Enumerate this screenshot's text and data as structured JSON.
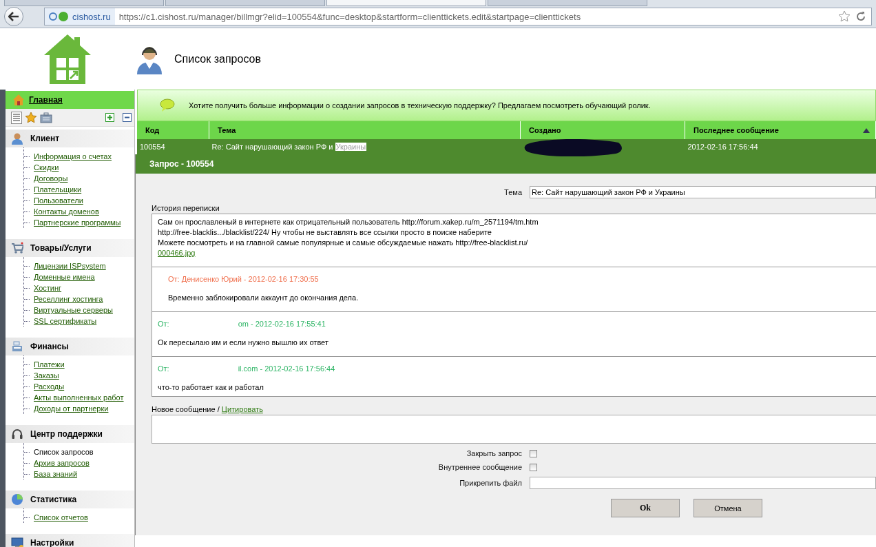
{
  "browser": {
    "tabs": [
      {
        "selected": false
      },
      {
        "selected": false
      },
      {
        "selected": true
      },
      {
        "selected": false
      }
    ],
    "site_badge": "cishost.ru",
    "url": "https://c1.cishost.ru/manager/billmgr?elid=100554&func=desktop&startform=clienttickets.edit&startpage=clienttickets"
  },
  "page_title": "Список запросов",
  "sidebar": {
    "home": "Главная",
    "groups": [
      {
        "title": "Клиент",
        "items": [
          {
            "label": "Информация о счетах",
            "selected": false
          },
          {
            "label": "Скидки",
            "selected": false
          },
          {
            "label": "Договоры",
            "selected": false
          },
          {
            "label": "Плательщики",
            "selected": false
          },
          {
            "label": "Пользователи",
            "selected": false
          },
          {
            "label": "Контакты доменов",
            "selected": false
          },
          {
            "label": "Партнерские программы",
            "selected": false
          }
        ]
      },
      {
        "title": "Товары/Услуги",
        "items": [
          {
            "label": "Лицензии ISPsystem",
            "selected": false
          },
          {
            "label": "Доменные имена",
            "selected": false
          },
          {
            "label": "Хостинг",
            "selected": false
          },
          {
            "label": "Реселлинг хостинга",
            "selected": false
          },
          {
            "label": "Виртуальные серверы",
            "selected": false
          },
          {
            "label": "SSL сертификаты",
            "selected": false
          }
        ]
      },
      {
        "title": "Финансы",
        "items": [
          {
            "label": "Платежи",
            "selected": false
          },
          {
            "label": "Заказы",
            "selected": false
          },
          {
            "label": "Расходы",
            "selected": false
          },
          {
            "label": "Акты выполненных работ",
            "selected": false
          },
          {
            "label": "Доходы от партнерки",
            "selected": false
          }
        ]
      },
      {
        "title": "Центр поддержки",
        "items": [
          {
            "label": "Список запросов",
            "selected": true
          },
          {
            "label": "Архив запросов",
            "selected": false
          },
          {
            "label": "База знаний",
            "selected": false
          }
        ]
      },
      {
        "title": "Статистика",
        "items": [
          {
            "label": "Список отчетов",
            "selected": false
          }
        ]
      },
      {
        "title": "Настройки"
      }
    ]
  },
  "banner": "Хотите получить больше информации о создании запросов в техническую поддержку? Предлагаем посмотреть обучающий ролик.",
  "table": {
    "columns": [
      {
        "label": "Код",
        "sorted": false
      },
      {
        "label": "Тема",
        "sorted": false
      },
      {
        "label": "Создано",
        "sorted": false
      },
      {
        "label": "Последнее сообщение",
        "sorted": true
      }
    ],
    "rows": [
      {
        "code": "100554",
        "topic": "Re: Сайт нарушающий закон РФ и",
        "topic_highlight": "Украины",
        "created_redacted": true,
        "last_message": "2012-02-16 17:56:44",
        "selected": true
      }
    ]
  },
  "dialog": {
    "title": "Запрос - 100554",
    "topic_label": "Тема",
    "topic_value": "Re: Сайт нарушающий закон РФ и  Украины",
    "history_label": "История переписки",
    "messages": [
      {
        "kind": "client",
        "lines": [
          "Сам он прославленый в интернете как отрицательный пользователь http://forum.xakep.ru/m_2571194/tm.htm",
          "http://free-blacklis.../blacklist/224/ Ну чтобы не выставлять все ссылки просто в поиске наберите",
          "Можете посмотреть и на главной самые популярные и самые обсуждаемые нажать http://free-blacklist.ru/"
        ],
        "attachment": "000466.jpg"
      },
      {
        "kind": "staff",
        "from": [
          "От: Денисенко Юрий - 2012-02-16 17:30:55"
        ],
        "lines": [
          "Временно заблокировали аккаунт до окончания дела."
        ]
      },
      {
        "kind": "client",
        "from": [
          "От:",
          "om - 2012-02-16 17:55:41"
        ],
        "lines": [
          "Ок пересылаю им и если нужно вышлю их ответ"
        ]
      },
      {
        "kind": "client",
        "from": [
          "От:",
          "il.com - 2012-02-16 17:56:44"
        ],
        "lines": [
          "что-то работает как и работал"
        ]
      }
    ],
    "new_message_label": "Новое сообщение /",
    "quote_link": "Цитировать",
    "options": [
      {
        "label": "Закрыть запрос",
        "checked": false
      },
      {
        "label": "Внутреннее сообщение",
        "checked": false
      }
    ],
    "attach_label": "Прикрепить файл",
    "buttons": [
      {
        "label": "Ok",
        "kind": "primary"
      },
      {
        "label": "Отмена",
        "kind": "secondary"
      }
    ]
  }
}
